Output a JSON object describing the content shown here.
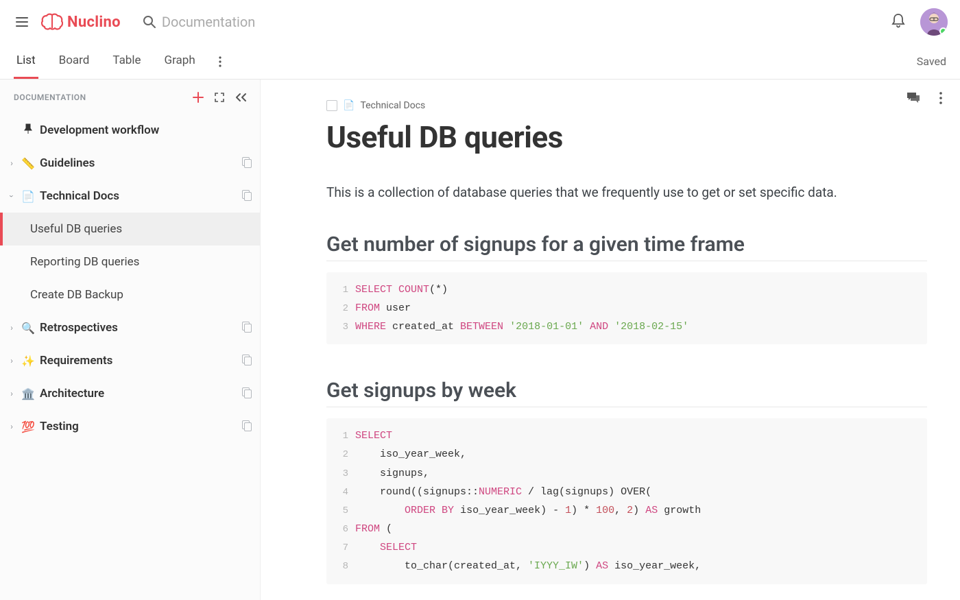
{
  "header": {
    "brand": "Nuclino",
    "search_placeholder": "Documentation",
    "saved_label": "Saved"
  },
  "tabs": {
    "items": [
      "List",
      "Board",
      "Table",
      "Graph"
    ],
    "active_index": 0
  },
  "sidebar": {
    "title": "DOCUMENTATION",
    "pinned": {
      "icon": "📌",
      "label": "Development workflow"
    },
    "sections": [
      {
        "icon": "📏",
        "label": "Guidelines",
        "expanded": false
      },
      {
        "icon": "📄",
        "label": "Technical Docs",
        "expanded": true,
        "children": [
          "Useful DB queries",
          "Reporting DB queries",
          "Create DB Backup"
        ],
        "selected_child": 0
      },
      {
        "icon": "🔍",
        "label": "Retrospectives",
        "expanded": false
      },
      {
        "icon": "✨",
        "label": "Requirements",
        "expanded": false
      },
      {
        "icon": "🏛️",
        "label": "Architecture",
        "expanded": false
      },
      {
        "icon": "💯",
        "label": "Testing",
        "expanded": false
      }
    ]
  },
  "doc": {
    "breadcrumb_icon": "📄",
    "breadcrumb": "Technical Docs",
    "title": "Useful DB queries",
    "intro": "This is a collection of database queries that we frequently use to get or set specific data.",
    "section1_title": "Get number of signups for a given time frame",
    "section2_title": "Get signups by week"
  },
  "code1": {
    "l1": {
      "n": "1",
      "kw1": "SELECT",
      "kw2": "COUNT",
      "rest": "(*)"
    },
    "l2": {
      "n": "2",
      "kw": "FROM",
      "rest": " user"
    },
    "l3": {
      "n": "3",
      "kw1": "WHERE",
      "mid": " created_at ",
      "kw2": "BETWEEN",
      "s1": "'2018-01-01'",
      "kw3": " AND ",
      "s2": "'2018-02-15'"
    }
  },
  "code2": {
    "l1": {
      "n": "1",
      "kw": "SELECT"
    },
    "l2": {
      "n": "2",
      "txt": "    iso_year_week,"
    },
    "l3": {
      "n": "3",
      "txt": "    signups,"
    },
    "l4": {
      "n": "4",
      "a": "    round((signups::",
      "kw": "NUMERIC",
      "b": " / lag(signups) OVER("
    },
    "l5": {
      "n": "5",
      "pad": "        ",
      "kw1": "ORDER",
      "sp": " ",
      "kw2": "BY",
      "a": " iso_year_week) - ",
      "n1": "1",
      "b": ") * ",
      "n2": "100",
      "c": ", ",
      "n3": "2",
      "d": ") ",
      "kw3": "AS",
      "e": " growth"
    },
    "l6": {
      "n": "6",
      "kw": "FROM",
      "rest": " ("
    },
    "l7": {
      "n": "7",
      "pad": "    ",
      "kw": "SELECT"
    },
    "l8": {
      "n": "8",
      "a": "        to_char(created_at, ",
      "s": "'IYYY_IW'",
      "b": ") ",
      "kw": "AS",
      "c": " iso_year_week,"
    }
  }
}
